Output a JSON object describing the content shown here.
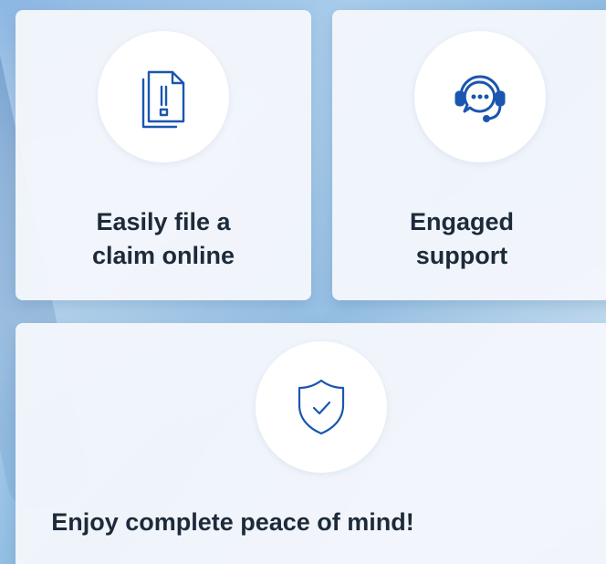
{
  "features": [
    {
      "title": "Easily file a\nclaim online",
      "icon": "document-alert-icon"
    },
    {
      "title": "Engaged\nsupport",
      "icon": "headset-chat-icon"
    },
    {
      "title": "Enjoy complete peace of mind!",
      "icon": "shield-check-icon"
    }
  ],
  "colors": {
    "icon_blue": "#1a56b0",
    "title_text": "#1d2a3a",
    "card_bg": "#f4f7fc"
  }
}
